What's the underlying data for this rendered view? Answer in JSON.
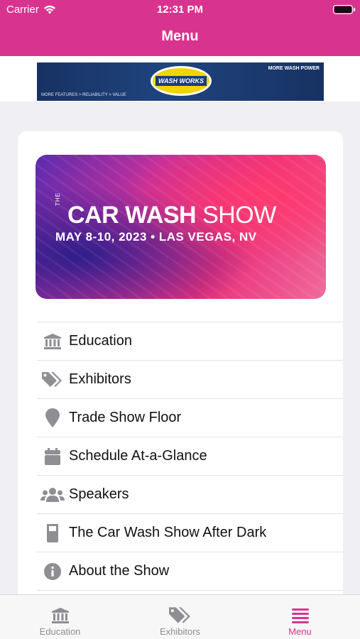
{
  "status_bar": {
    "carrier": "Carrier",
    "time": "12:31 PM"
  },
  "nav": {
    "title": "Menu"
  },
  "ad": {
    "brand": "WASH WORKS",
    "tagline_right": "MORE WASH POWER",
    "tagline_left": "MORE FEATURES > RELIABILITY > VALUE"
  },
  "banner": {
    "the": "THE",
    "title_bold": "CAR WASH",
    "title_light": "SHOW",
    "date_line": "MAY 8-10, 2023 • LAS VEGAS, NV"
  },
  "menu": {
    "items": [
      {
        "label": "Education",
        "icon": "bank-icon"
      },
      {
        "label": "Exhibitors",
        "icon": "tags-icon"
      },
      {
        "label": "Trade Show Floor",
        "icon": "map-pin-icon"
      },
      {
        "label": "Schedule At-a-Glance",
        "icon": "calendar-icon"
      },
      {
        "label": "Speakers",
        "icon": "users-icon"
      },
      {
        "label": "The Car Wash Show After Dark",
        "icon": "glass-icon"
      },
      {
        "label": "About the Show",
        "icon": "info-icon"
      }
    ]
  },
  "tabbar": {
    "tabs": [
      {
        "label": "Education",
        "icon": "bank-icon",
        "active": false
      },
      {
        "label": "Exhibitors",
        "icon": "tags-icon",
        "active": false
      },
      {
        "label": "Menu",
        "icon": "hamburger-menu-icon",
        "active": true
      }
    ]
  },
  "colors": {
    "accent": "#d8348f",
    "icon_gray": "#8e8e93",
    "text": "#111111"
  }
}
